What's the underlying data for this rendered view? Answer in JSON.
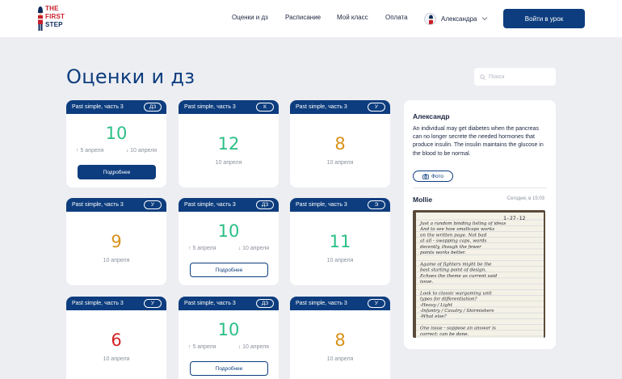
{
  "header": {
    "logo_lines": [
      "THE",
      "FIRST",
      "STEP"
    ],
    "nav": [
      "Оценки и дз",
      "Расписание",
      "Мой класс",
      "Оплата"
    ],
    "user_name": "Александра",
    "enter_button": "Войти в урок"
  },
  "page": {
    "title": "Оценки и дз",
    "search_placeholder": "Поиск"
  },
  "colors": {
    "brand": "#0d3d7e",
    "grade_green": "#2bbf86",
    "grade_orange": "#d8921a",
    "grade_red": "#d42424"
  },
  "cards": [
    {
      "topic": "Past simple, часть 3",
      "badge": "ДЗ",
      "grade": "10",
      "grade_color": "green",
      "dates": {
        "up": "↑ 5 апреля",
        "down": "↓ 10 апреля"
      },
      "button": "Подробнее",
      "button_style": "filled"
    },
    {
      "topic": "Past simple, часть 3",
      "badge": "К",
      "grade": "12",
      "grade_color": "green",
      "date": "10 апреля"
    },
    {
      "topic": "Past simple, часть 3",
      "badge": "У",
      "grade": "8",
      "grade_color": "orange",
      "date": "10 апреля"
    },
    {
      "topic": "Past simple, часть 3",
      "badge": "У",
      "grade": "9",
      "grade_color": "orange",
      "date": "10 апреля"
    },
    {
      "topic": "Past simple, часть 3",
      "badge": "ДЗ",
      "grade": "10",
      "grade_color": "green",
      "dates": {
        "up": "↑ 5 апреля",
        "down": "↓ 10 апреля"
      },
      "button": "Подробнее",
      "button_style": "outline"
    },
    {
      "topic": "Past simple, часть 3",
      "badge": "Э",
      "grade": "11",
      "grade_color": "green",
      "date": "10 апреля"
    },
    {
      "topic": "Past simple, часть 3",
      "badge": "У",
      "grade": "6",
      "grade_color": "red",
      "date": "10 апреля"
    },
    {
      "topic": "Past simple, часть 3",
      "badge": "ДЗ",
      "grade": "10",
      "grade_color": "green",
      "dates": {
        "up": "↑ 5 апреля",
        "down": "↓ 10 апреля"
      },
      "button": "Подробнее",
      "button_style": "outline"
    },
    {
      "topic": "Past simple, часть 3",
      "badge": "У",
      "grade": "8",
      "grade_color": "orange",
      "date": "10 апреля"
    }
  ],
  "chat": {
    "message1": {
      "author": "Александр",
      "text": "An individual may get diabetes when the pancreas can no longer secrete the needed hormones that produce insulin. The insulin maintains the glucose in the blood to be normal.",
      "photo_button": "Фото"
    },
    "message2": {
      "author": "Mollie",
      "time": "Сегодня, в 15:03",
      "note_lines": [
        "Just a random binding listing of ideas",
        "And to see how smallcaps works",
        "on the written page. Not bad",
        "at all - swapping caps, words",
        "decently, though the fewer",
        "points works better.",
        "",
        "Agame of fighters might be the",
        "best starting point of design.",
        "Echoes the theme as current said",
        "issue.",
        "",
        "Look to classic wargaming unit",
        "types for differentiation?",
        "-Heavy / Light",
        "-Infantry / Cavalry / Skirmishers",
        "-What else?",
        "",
        "One issue - suppose an answer is",
        "correct: can be done."
      ],
      "note_date": "1-27-12"
    }
  }
}
